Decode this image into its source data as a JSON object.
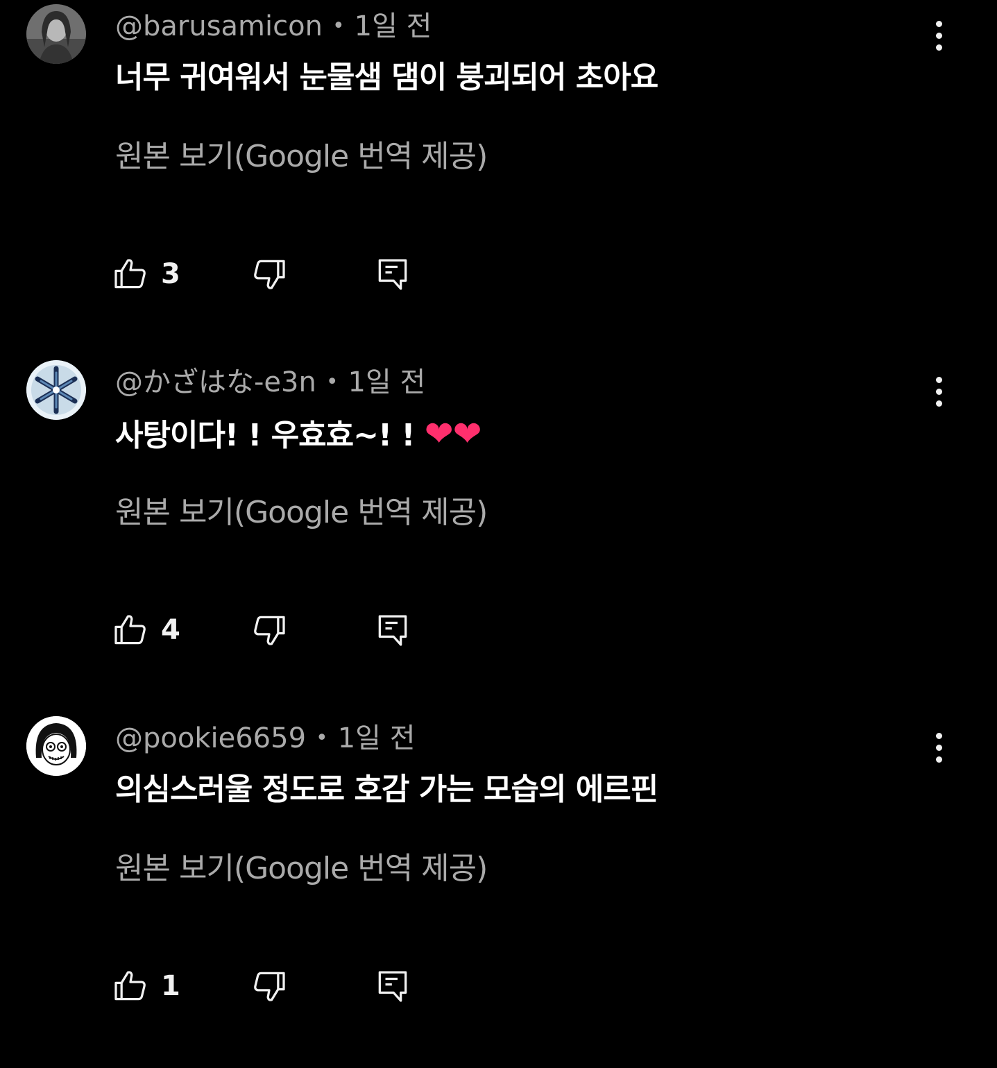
{
  "comments": [
    {
      "handle": "@barusamicon",
      "time": "1일 전",
      "text": "너무 귀여워서 눈물샘 댐이 붕괴되어 초아요",
      "translate_label": "원본 보기(Google 번역 제공)",
      "likes": "3"
    },
    {
      "handle": "@かざはな-e3n",
      "time": "1일 전",
      "text": "사탕이다! ! 우효효~! !",
      "text_emoji": "❤❤",
      "translate_label": "원본 보기(Google 번역 제공)",
      "likes": "4"
    },
    {
      "handle": "@pookie6659",
      "time": "1일 전",
      "text": "의심스러울 정도로 호감 가는 모습의 에르핀",
      "translate_label": "원본 보기(Google 번역 제공)",
      "likes": "1"
    }
  ],
  "separator": "•",
  "icons": {
    "like": "thumbs-up-icon",
    "dislike": "thumbs-down-icon",
    "reply": "reply-comment-icon",
    "menu": "more-vert-icon"
  },
  "colors": {
    "background": "#000000",
    "primary_text": "#ffffff",
    "secondary_text": "#aaaaaa",
    "heart": "#ff2f6d"
  }
}
